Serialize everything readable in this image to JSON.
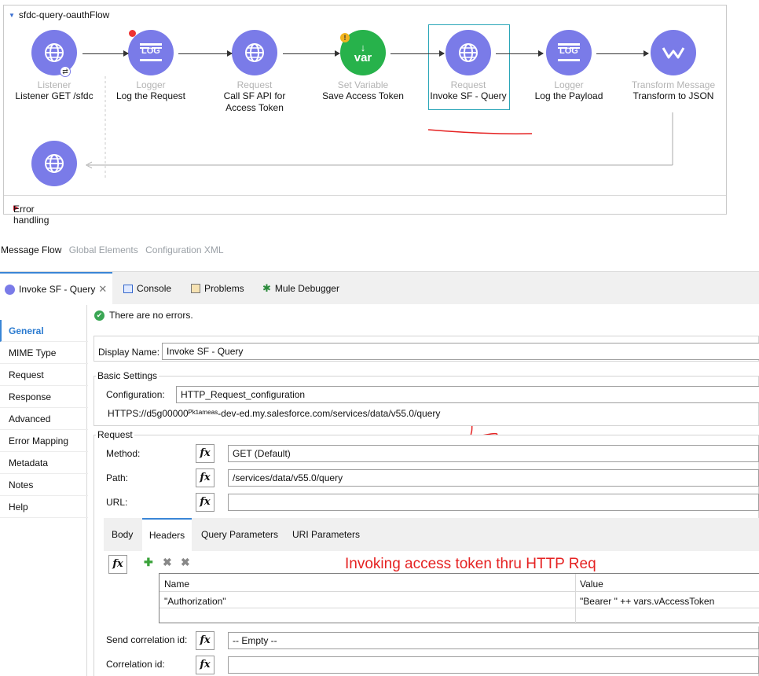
{
  "flow": {
    "title": "sfdc-query-oauthFlow",
    "nodes": [
      {
        "type": "Listener",
        "name": "Listener GET /sfdc",
        "icon": "globe-icon"
      },
      {
        "type": "Logger",
        "name": "Log the Request",
        "icon": "log-icon"
      },
      {
        "type": "Request",
        "name": "Call SF API for Access Token",
        "icon": "globe-icon"
      },
      {
        "type": "Set Variable",
        "name": "Save Access Token",
        "icon": "var-icon",
        "icon_text": "var"
      },
      {
        "type": "Request",
        "name": "Invoke SF - Query",
        "icon": "globe-icon"
      },
      {
        "type": "Logger",
        "name": "Log the Payload",
        "icon": "log-icon"
      },
      {
        "type": "Transform Message",
        "name": "Transform to JSON",
        "icon": "transform-icon"
      }
    ],
    "log_badge": "LOG",
    "error_handling": "Error handling"
  },
  "message_flow_tabs": [
    "Message Flow",
    "Global Elements",
    "Configuration XML"
  ],
  "panel_tabs": [
    {
      "label": "Invoke SF - Query"
    },
    {
      "label": "Console"
    },
    {
      "label": "Problems"
    },
    {
      "label": "Mule Debugger"
    }
  ],
  "nav": [
    "General",
    "MIME Type",
    "Request",
    "Response",
    "Advanced",
    "Error Mapping",
    "Metadata",
    "Notes",
    "Help"
  ],
  "status": "There are no errors.",
  "display_name": {
    "label": "Display Name:",
    "value": "Invoke SF - Query"
  },
  "basic_settings": {
    "title": "Basic Settings",
    "configuration_label": "Configuration:",
    "configuration_value": "HTTP_Request_configuration",
    "url_preview": "HTTPS://d5g00000ᴾᵏ¹ᵃᵐᵉᵃˢ-dev-ed.my.salesforce.com/services/data/v55.0/query"
  },
  "request": {
    "title": "Request",
    "method_label": "Method:",
    "method_value": "GET (Default)",
    "path_label": "Path:",
    "path_value": "/services/data/v55.0/query",
    "url_label": "URL:",
    "url_value": "",
    "fx": "fx"
  },
  "inner_tabs": [
    "Body",
    "Headers",
    "Query Parameters",
    "URI Parameters"
  ],
  "headers_table": {
    "columns": [
      "Name",
      "Value"
    ],
    "rows": [
      {
        "name": "\"Authorization\"",
        "value": "\"Bearer \" ++ vars.vAccessToken"
      }
    ]
  },
  "annotation": "Invoking access token thru HTTP Req",
  "correlation": {
    "send_label": "Send correlation id:",
    "send_value": "-- Empty --",
    "id_label": "Correlation id:",
    "id_value": ""
  },
  "colors": {
    "node_purple": "#7a7be8",
    "node_green": "#27b24b",
    "selection": "#2aa6b8",
    "annotation_red": "#e52222",
    "accent_blue": "#3a86d6"
  }
}
